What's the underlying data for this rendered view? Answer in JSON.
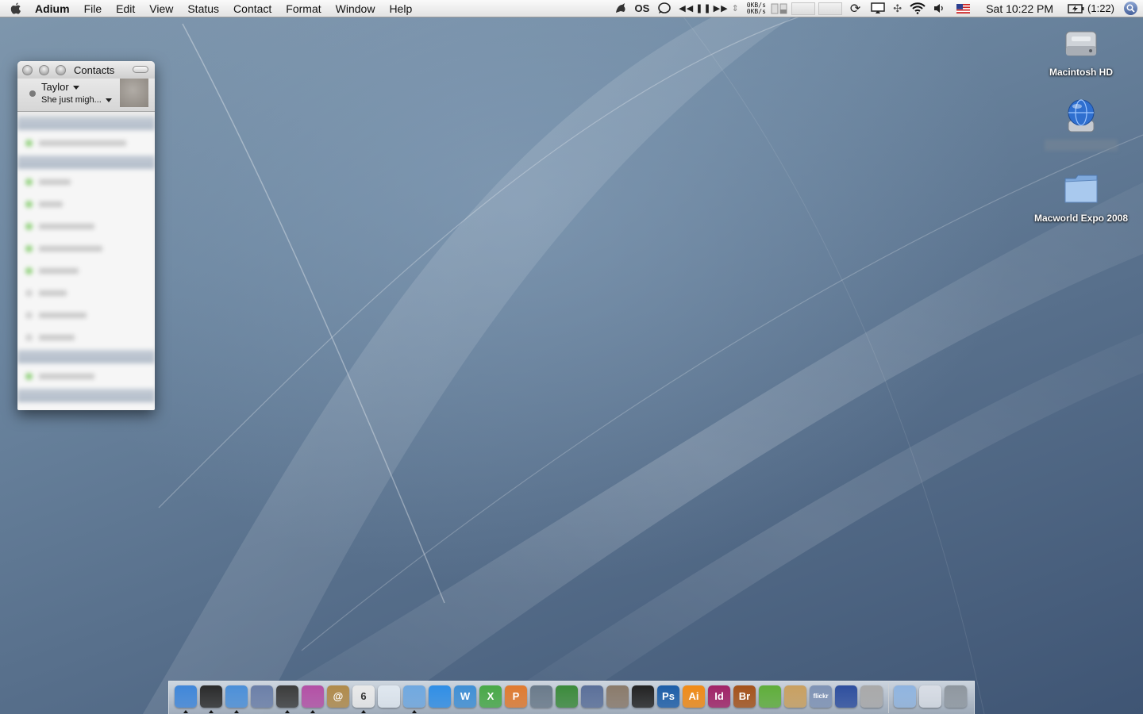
{
  "menubar": {
    "app_name": "Adium",
    "menus": [
      "File",
      "Edit",
      "View",
      "Status",
      "Contact",
      "Format",
      "Window",
      "Help"
    ],
    "extras": {
      "os_label": "OS",
      "net_up": "0KB/s",
      "net_down": "0KB/s",
      "clock": "Sat 10:22 PM",
      "battery": "(1:22)"
    }
  },
  "contacts_window": {
    "title": "Contacts",
    "user_name": "Taylor",
    "status_message": "She just migh..."
  },
  "desktop_icons": [
    {
      "label": "Macintosh HD",
      "icon": "hard-drive-icon"
    },
    {
      "label": "",
      "icon": "network-globe-icon"
    },
    {
      "label": "Macworld Expo 2008",
      "icon": "folder-icon"
    }
  ],
  "dock": {
    "apps": [
      {
        "name": "finder",
        "text": "",
        "color": "#3f86d9"
      },
      {
        "name": "dashboard",
        "text": "",
        "color": "#2a2a2a"
      },
      {
        "name": "safari",
        "text": "",
        "color": "#4b8fd8"
      },
      {
        "name": "mail-stamp",
        "text": "",
        "color": "#6b7fa8"
      },
      {
        "name": "adium-duck",
        "text": "",
        "color": "#3b3b3b"
      },
      {
        "name": "widget-orb",
        "text": "",
        "color": "#b34fa5"
      },
      {
        "name": "address-book",
        "text": "@",
        "color": "#b08a4a"
      },
      {
        "name": "ical",
        "text": "6",
        "color": "#e9e9e9"
      },
      {
        "name": "preview",
        "text": "",
        "color": "#dfe7ef"
      },
      {
        "name": "itunes",
        "text": "",
        "color": "#6fa8e0"
      },
      {
        "name": "quicktime",
        "text": "",
        "color": "#2f8ee6"
      },
      {
        "name": "word",
        "text": "W",
        "color": "#3f8fd5"
      },
      {
        "name": "excel",
        "text": "X",
        "color": "#48a946"
      },
      {
        "name": "powerpoint",
        "text": "P",
        "color": "#e07a2f"
      },
      {
        "name": "script-editor",
        "text": "",
        "color": "#6a7a8a"
      },
      {
        "name": "numbers",
        "text": "",
        "color": "#3b8a3b"
      },
      {
        "name": "keynote",
        "text": "",
        "color": "#5a6f99"
      },
      {
        "name": "iphoto",
        "text": "",
        "color": "#8a7a6a"
      },
      {
        "name": "aperture",
        "text": "",
        "color": "#222222"
      },
      {
        "name": "photoshop",
        "text": "Ps",
        "color": "#1d5ea8"
      },
      {
        "name": "illustrator",
        "text": "Ai",
        "color": "#f08a16"
      },
      {
        "name": "indesign",
        "text": "Id",
        "color": "#a12266"
      },
      {
        "name": "bridge",
        "text": "Br",
        "color": "#a4521a"
      },
      {
        "name": "coda-leaf",
        "text": "",
        "color": "#5fae3a"
      },
      {
        "name": "transmit-truck",
        "text": "",
        "color": "#c9a060"
      },
      {
        "name": "flickr-uploadr",
        "text": "flickr",
        "color": "#7f93b5"
      },
      {
        "name": "cyberduck",
        "text": "",
        "color": "#2d4e9e"
      },
      {
        "name": "system-preferences",
        "text": "",
        "color": "#a9a9a9"
      }
    ],
    "stacks": [
      {
        "name": "documents-folder",
        "color": "#8fb4e0"
      },
      {
        "name": "downloads-stack",
        "color": "#d8dde5"
      },
      {
        "name": "trash",
        "color": "#8e969e"
      }
    ]
  }
}
